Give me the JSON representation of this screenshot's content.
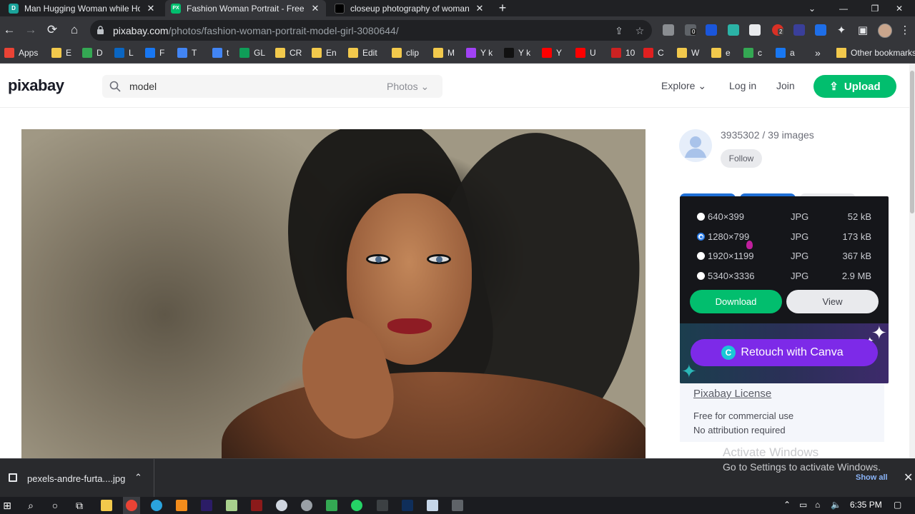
{
  "browser": {
    "tabs": [
      {
        "title": "Man Hugging Woman while Holding",
        "favicon": "D",
        "favicon_color": "#1aa39a",
        "active": false
      },
      {
        "title": "Fashion Woman Portrait - Free photo",
        "favicon": "PX",
        "favicon_color": "#02be6e",
        "active": true
      },
      {
        "title": "closeup photography of woman",
        "favicon": "",
        "favicon_color": "#000000",
        "active": false
      }
    ],
    "url_host": "pixabay.com",
    "url_path": "/photos/fashion-woman-portrait-model-girl-3080644/",
    "extension_badge_1": "0",
    "extension_badge_2": "2",
    "bookmarks": [
      {
        "label": "Apps",
        "icon": "apps-grid-icon",
        "color": "#ea4335"
      },
      {
        "label": "E",
        "icon": "folder-icon",
        "color": "#f2c94c"
      },
      {
        "label": "D",
        "icon": "drive-icon",
        "color": "#34a853"
      },
      {
        "label": "L",
        "icon": "linkedin-icon",
        "color": "#0a66c2"
      },
      {
        "label": "F",
        "icon": "facebook-icon",
        "color": "#1877f2"
      },
      {
        "label": "T",
        "icon": "translate-icon",
        "color": "#4285f4"
      },
      {
        "label": "t",
        "icon": "docs-icon",
        "color": "#4285f4"
      },
      {
        "label": "GL",
        "icon": "sheets-icon",
        "color": "#0f9d58"
      },
      {
        "label": "CR",
        "icon": "folder-icon",
        "color": "#f2c94c"
      },
      {
        "label": "En",
        "icon": "folder-icon",
        "color": "#f2c94c"
      },
      {
        "label": "Edit",
        "icon": "folder-icon",
        "color": "#f2c94c"
      },
      {
        "label": "clip",
        "icon": "folder-icon",
        "color": "#f2c94c"
      },
      {
        "label": "M",
        "icon": "folder-icon",
        "color": "#f2c94c"
      },
      {
        "label": "Y k",
        "icon": "script-icon",
        "color": "#a142f4"
      },
      {
        "label": "Y k",
        "icon": "r-icon",
        "color": "#111111"
      },
      {
        "label": "Y",
        "icon": "youtube-icon",
        "color": "#ff0000"
      },
      {
        "label": "U",
        "icon": "youtube-icon",
        "color": "#ff0000"
      },
      {
        "label": "10",
        "icon": "pin-icon",
        "color": "#cc2222"
      },
      {
        "label": "C",
        "icon": "acrobat-icon",
        "color": "#e02020"
      },
      {
        "label": "W",
        "icon": "folder-icon",
        "color": "#f2c94c"
      },
      {
        "label": "e",
        "icon": "folder-icon",
        "color": "#f2c94c"
      },
      {
        "label": "c",
        "icon": "drive-icon",
        "color": "#34a853"
      },
      {
        "label": "a",
        "icon": "facebook-icon",
        "color": "#1877f2"
      }
    ],
    "more_bookmarks": "»",
    "other_bookmarks": "Other bookmarks"
  },
  "site": {
    "logo": "pixabay",
    "search_value": "model",
    "search_type": "Photos",
    "nav": {
      "explore": "Explore",
      "login": "Log in",
      "join": "Join",
      "upload": "Upload"
    },
    "author": {
      "name": "3935302 / 39 images",
      "follow": "Follow"
    },
    "sizes": [
      {
        "dim": "640×399",
        "format": "JPG",
        "size": "52 kB",
        "selected": false
      },
      {
        "dim": "1280×799",
        "format": "JPG",
        "size": "173 kB",
        "selected": true
      },
      {
        "dim": "1920×1199",
        "format": "JPG",
        "size": "367 kB",
        "selected": false
      },
      {
        "dim": "5340×3336",
        "format": "JPG",
        "size": "2.9 MB",
        "selected": false
      }
    ],
    "download_label": "Download",
    "view_label": "View",
    "canva_label": "Retouch with Canva",
    "canva_logo": "C",
    "license": {
      "title": "Pixabay License",
      "line1": "Free for commercial use",
      "line2": "No attribution required"
    },
    "colors": {
      "brand_green": "#02be6e",
      "canva_purple": "#7d2ae8"
    }
  },
  "watermark": {
    "title": "Activate Windows",
    "subtitle": "Go to Settings to activate Windows."
  },
  "downloads": {
    "file": "pexels-andre-furta....jpg",
    "show_all": "Show all"
  },
  "taskbar": {
    "time": "6:35 PM"
  }
}
